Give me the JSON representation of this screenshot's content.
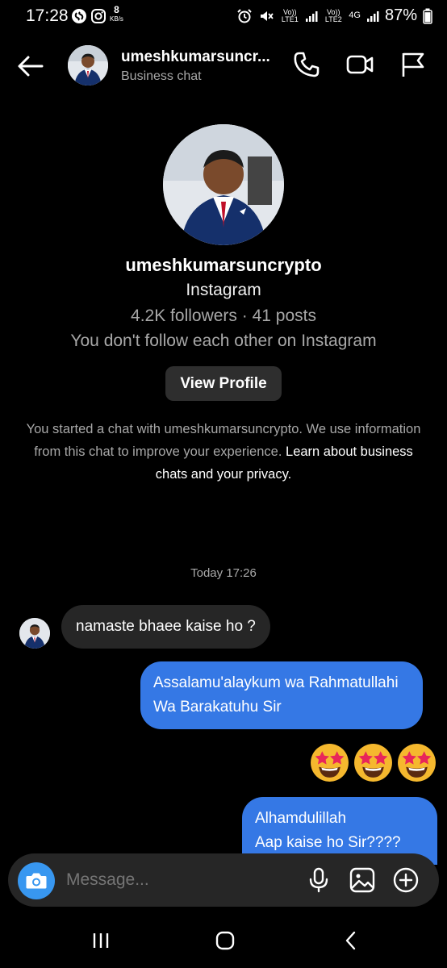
{
  "status_bar": {
    "time": "17:28",
    "speed_value": "8",
    "speed_unit": "KB/s",
    "sim1": "Vo)) LTE1",
    "sim2": "Vo)) LTE2",
    "network": "4G",
    "battery": "87%"
  },
  "header": {
    "name": "umeshkumarsuncr...",
    "subtitle": "Business chat"
  },
  "profile": {
    "username": "umeshkumarsuncrypto",
    "source": "Instagram",
    "stats": "4.2K followers · 41 posts",
    "follow_status": "You don't follow each other on Instagram",
    "view_button": "View Profile"
  },
  "info": {
    "text": "You started a chat with umeshkumarsuncrypto. We use information from this chat to improve your experience.",
    "link": "Learn about business chats and your privacy."
  },
  "timestamp": "Today 17:26",
  "messages": [
    {
      "from": "them",
      "text": "namaste bhaee kaise ho ?"
    },
    {
      "from": "me",
      "text": "Assalamu'alaykum wa Rahmatullahi Wa Barakatuhu Sir"
    },
    {
      "from": "me",
      "emoji": "star-struck-emoji",
      "count": 3
    },
    {
      "from": "me",
      "text": "Alhamdulillah\nAap kaise ho Sir????"
    }
  ],
  "composer": {
    "placeholder": "Message..."
  },
  "colors": {
    "background": "#000000",
    "outgoing_bubble": "#3578e5",
    "incoming_bubble": "#262626",
    "camera_button": "#3897f0",
    "secondary_text": "#a8a8a8"
  }
}
